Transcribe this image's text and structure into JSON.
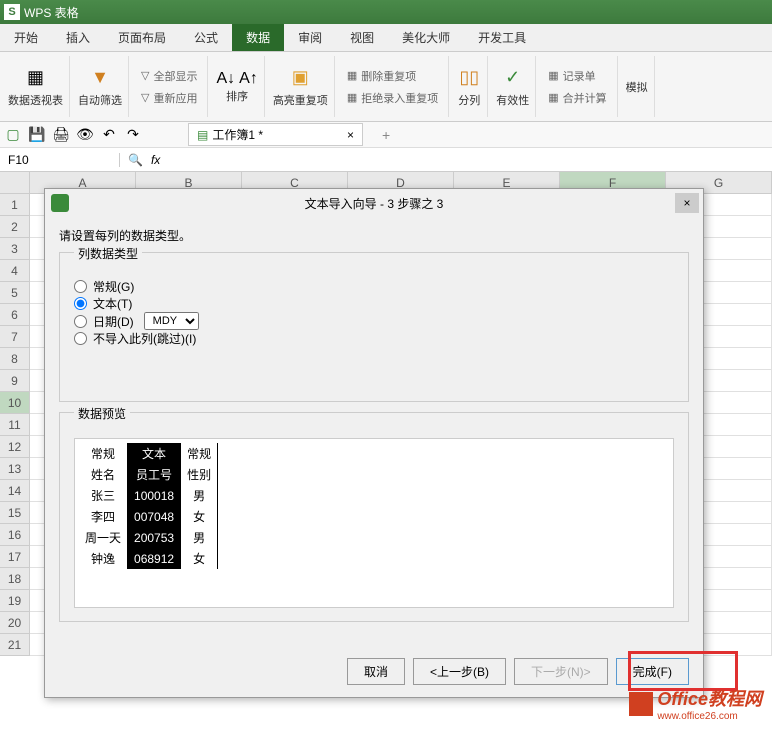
{
  "app": {
    "logo": "S",
    "title": "WPS 表格"
  },
  "menu": {
    "items": [
      "开始",
      "插入",
      "页面布局",
      "公式",
      "数据",
      "审阅",
      "视图",
      "美化大师",
      "开发工具"
    ],
    "active_index": 4
  },
  "ribbon": {
    "pivot": "数据透视表",
    "autofilter": "自动筛选",
    "showall": "全部显示",
    "reapply": "重新应用",
    "sort": "排序",
    "highlight": "高亮重复项",
    "remove_dup": "删除重复项",
    "reject_dup": "拒绝录入重复项",
    "text_to_cols": "分列",
    "validation": "有效性",
    "record_form": "记录单",
    "consolidate": "合并计算",
    "what_if": "模拟"
  },
  "quickbar": {
    "workbook_tab": "工作簿1 *"
  },
  "formula": {
    "namebox": "F10",
    "fx": "fx"
  },
  "grid": {
    "columns": [
      "A",
      "B",
      "C",
      "D",
      "E",
      "F",
      "G"
    ],
    "rows": [
      "1",
      "2",
      "3",
      "4",
      "5",
      "6",
      "7",
      "8",
      "9",
      "10",
      "11",
      "12",
      "13",
      "14",
      "15",
      "16",
      "17",
      "18",
      "19",
      "20",
      "21"
    ],
    "active_col": "F",
    "active_row": "10"
  },
  "dialog": {
    "title": "文本导入向导 - 3 步骤之 3",
    "instruction": "请设置每列的数据类型。",
    "group_label": "列数据类型",
    "radio_general": "常规(G)",
    "radio_text": "文本(T)",
    "radio_date": "日期(D)",
    "date_format": "MDY",
    "radio_skip": "不导入此列(跳过)(I)",
    "preview_label": "数据预览",
    "preview_headers": [
      "常规",
      "文本",
      "常规"
    ],
    "preview_rows": [
      [
        "姓名",
        "员工号",
        "性别"
      ],
      [
        "张三",
        "100018",
        "男"
      ],
      [
        "李四",
        "007048",
        "女"
      ],
      [
        "周一天",
        "200753",
        "男"
      ],
      [
        "钟逸",
        "068912",
        "女"
      ]
    ],
    "selected_col_index": 1,
    "btn_cancel": "取消",
    "btn_back": "<上一步(B)",
    "btn_next": "下一步(N)>",
    "btn_finish": "完成(F)"
  },
  "watermark": {
    "text1": "Office教程网",
    "text2": "www.office26.com"
  }
}
